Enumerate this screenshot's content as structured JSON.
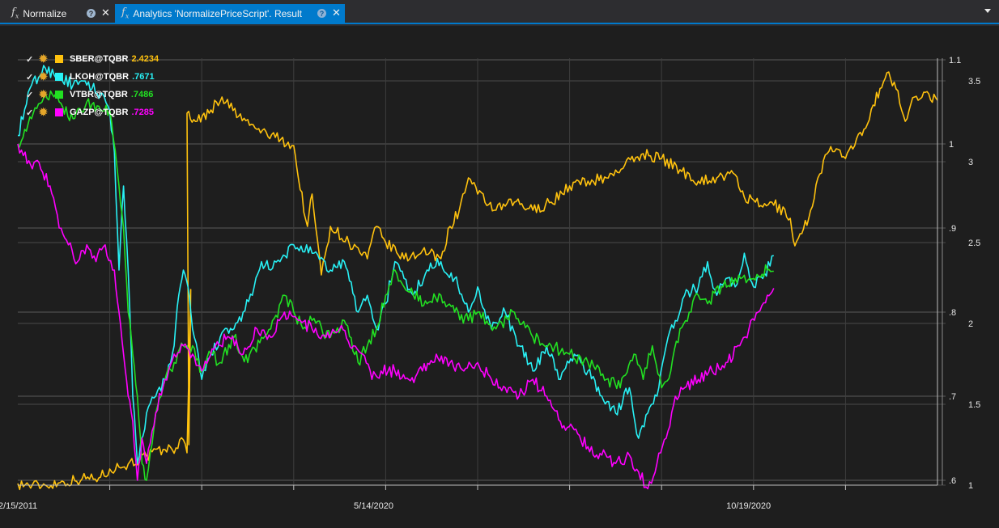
{
  "tabs": [
    {
      "label": "Normalize",
      "icon": "function-icon"
    },
    {
      "label": "Analytics 'NormalizePriceScript'. Result",
      "icon": "function-icon"
    }
  ],
  "chart_data": {
    "type": "line",
    "x_tick_labels": [
      "2/15/2011",
      "5/14/2020",
      "10/19/2020"
    ],
    "y_axis_inner": {
      "ticks": [
        "1.1",
        "1",
        ".9",
        ".8",
        ".7",
        ".6"
      ],
      "range": [
        0.6,
        1.1
      ]
    },
    "y_axis_outer": {
      "ticks": [
        "3.5",
        "3",
        "2.5",
        "2",
        "1.5",
        "1"
      ],
      "range": [
        1.0,
        3.5
      ]
    },
    "legend_position": "top-left",
    "series": [
      {
        "name": "SBER@TQBR",
        "last_value": "2.4234",
        "color": "#ffc20e",
        "axis": "outer",
        "points": [
          [
            0.0,
            1.01
          ],
          [
            0.012,
            1.0
          ],
          [
            0.03,
            1.0
          ],
          [
            0.05,
            1.02
          ],
          [
            0.07,
            1.04
          ],
          [
            0.09,
            1.05
          ],
          [
            0.1,
            1.1
          ],
          [
            0.12,
            1.13
          ],
          [
            0.14,
            1.18
          ],
          [
            0.16,
            1.22
          ],
          [
            0.172,
            1.23
          ],
          [
            0.18,
            1.28
          ],
          [
            0.184,
            1.2
          ],
          [
            0.188,
            2.21
          ],
          [
            0.186,
            1.25
          ],
          [
            0.184,
            3.3
          ],
          [
            0.195,
            3.25
          ],
          [
            0.21,
            3.32
          ],
          [
            0.222,
            3.4
          ],
          [
            0.24,
            3.28
          ],
          [
            0.26,
            3.2
          ],
          [
            0.28,
            3.15
          ],
          [
            0.3,
            3.1
          ],
          [
            0.305,
            2.9
          ],
          [
            0.315,
            2.6
          ],
          [
            0.32,
            2.8
          ],
          [
            0.33,
            2.3
          ],
          [
            0.34,
            2.6
          ],
          [
            0.36,
            2.5
          ],
          [
            0.38,
            2.4
          ],
          [
            0.39,
            2.6
          ],
          [
            0.4,
            2.5
          ],
          [
            0.42,
            2.4
          ],
          [
            0.44,
            2.45
          ],
          [
            0.46,
            2.4
          ],
          [
            0.47,
            2.6
          ],
          [
            0.48,
            2.7
          ],
          [
            0.49,
            2.9
          ],
          [
            0.5,
            2.8
          ],
          [
            0.52,
            2.7
          ],
          [
            0.54,
            2.75
          ],
          [
            0.56,
            2.7
          ],
          [
            0.58,
            2.75
          ],
          [
            0.6,
            2.85
          ],
          [
            0.62,
            2.88
          ],
          [
            0.64,
            2.9
          ],
          [
            0.66,
            2.98
          ],
          [
            0.68,
            3.05
          ],
          [
            0.7,
            3.02
          ],
          [
            0.72,
            2.95
          ],
          [
            0.74,
            2.88
          ],
          [
            0.76,
            2.9
          ],
          [
            0.78,
            2.92
          ],
          [
            0.79,
            2.78
          ],
          [
            0.81,
            2.72
          ],
          [
            0.82,
            2.75
          ],
          [
            0.84,
            2.65
          ],
          [
            0.845,
            2.48
          ],
          [
            0.86,
            2.65
          ],
          [
            0.87,
            2.9
          ],
          [
            0.88,
            3.05
          ],
          [
            0.89,
            3.08
          ],
          [
            0.9,
            3.02
          ],
          [
            0.91,
            3.1
          ],
          [
            0.92,
            3.2
          ],
          [
            0.93,
            3.35
          ],
          [
            0.945,
            3.55
          ],
          [
            0.955,
            3.45
          ],
          [
            0.965,
            3.25
          ],
          [
            0.975,
            3.4
          ],
          [
            0.985,
            3.43
          ],
          [
            1.0,
            3.38
          ]
        ]
      },
      {
        "name": "LKOH@TQBR",
        "last_value": ".7671",
        "color": "#28f1f5",
        "axis": "inner",
        "points": [
          [
            0.0,
            1.01
          ],
          [
            0.015,
            1.07
          ],
          [
            0.03,
            1.09
          ],
          [
            0.045,
            1.08
          ],
          [
            0.06,
            1.07
          ],
          [
            0.075,
            1.07
          ],
          [
            0.09,
            1.06
          ],
          [
            0.1,
            1.04
          ],
          [
            0.105,
            0.99
          ],
          [
            0.11,
            0.85
          ],
          [
            0.115,
            0.95
          ],
          [
            0.12,
            0.85
          ],
          [
            0.125,
            0.7
          ],
          [
            0.13,
            0.62
          ],
          [
            0.14,
            0.68
          ],
          [
            0.15,
            0.7
          ],
          [
            0.16,
            0.72
          ],
          [
            0.17,
            0.76
          ],
          [
            0.175,
            0.82
          ],
          [
            0.18,
            0.85
          ],
          [
            0.185,
            0.83
          ],
          [
            0.19,
            0.78
          ],
          [
            0.2,
            0.72
          ],
          [
            0.21,
            0.75
          ],
          [
            0.22,
            0.77
          ],
          [
            0.235,
            0.78
          ],
          [
            0.245,
            0.8
          ],
          [
            0.255,
            0.82
          ],
          [
            0.265,
            0.86
          ],
          [
            0.275,
            0.85
          ],
          [
            0.285,
            0.86
          ],
          [
            0.3,
            0.88
          ],
          [
            0.32,
            0.87
          ],
          [
            0.34,
            0.85
          ],
          [
            0.355,
            0.86
          ],
          [
            0.37,
            0.8
          ],
          [
            0.38,
            0.82
          ],
          [
            0.39,
            0.78
          ],
          [
            0.4,
            0.81
          ],
          [
            0.41,
            0.86
          ],
          [
            0.42,
            0.84
          ],
          [
            0.43,
            0.82
          ],
          [
            0.445,
            0.85
          ],
          [
            0.46,
            0.86
          ],
          [
            0.475,
            0.84
          ],
          [
            0.49,
            0.8
          ],
          [
            0.5,
            0.83
          ],
          [
            0.515,
            0.78
          ],
          [
            0.53,
            0.8
          ],
          [
            0.545,
            0.76
          ],
          [
            0.56,
            0.73
          ],
          [
            0.575,
            0.76
          ],
          [
            0.59,
            0.72
          ],
          [
            0.605,
            0.75
          ],
          [
            0.62,
            0.73
          ],
          [
            0.635,
            0.7
          ],
          [
            0.65,
            0.68
          ],
          [
            0.665,
            0.71
          ],
          [
            0.675,
            0.65
          ],
          [
            0.685,
            0.68
          ],
          [
            0.695,
            0.7
          ],
          [
            0.705,
            0.76
          ],
          [
            0.715,
            0.79
          ],
          [
            0.725,
            0.82
          ],
          [
            0.74,
            0.83
          ],
          [
            0.75,
            0.86
          ],
          [
            0.76,
            0.82
          ],
          [
            0.77,
            0.84
          ],
          [
            0.78,
            0.83
          ],
          [
            0.79,
            0.87
          ],
          [
            0.8,
            0.83
          ],
          [
            0.81,
            0.84
          ],
          [
            0.822,
            0.8671
          ]
        ]
      },
      {
        "name": "VTBR@TQBR",
        "last_value": ".7486",
        "color": "#22e022",
        "axis": "inner",
        "points": [
          [
            0.0,
            1.0
          ],
          [
            0.015,
            1.03
          ],
          [
            0.03,
            1.06
          ],
          [
            0.045,
            1.05
          ],
          [
            0.06,
            1.03
          ],
          [
            0.075,
            1.05
          ],
          [
            0.09,
            1.04
          ],
          [
            0.1,
            1.04
          ],
          [
            0.11,
            0.95
          ],
          [
            0.115,
            0.9
          ],
          [
            0.12,
            0.8
          ],
          [
            0.125,
            0.75
          ],
          [
            0.13,
            0.7
          ],
          [
            0.135,
            0.62
          ],
          [
            0.14,
            0.6
          ],
          [
            0.15,
            0.68
          ],
          [
            0.16,
            0.72
          ],
          [
            0.17,
            0.74
          ],
          [
            0.18,
            0.76
          ],
          [
            0.19,
            0.76
          ],
          [
            0.2,
            0.73
          ],
          [
            0.21,
            0.75
          ],
          [
            0.22,
            0.74
          ],
          [
            0.235,
            0.77
          ],
          [
            0.25,
            0.74
          ],
          [
            0.265,
            0.77
          ],
          [
            0.275,
            0.78
          ],
          [
            0.29,
            0.82
          ],
          [
            0.3,
            0.8
          ],
          [
            0.31,
            0.78
          ],
          [
            0.32,
            0.79
          ],
          [
            0.34,
            0.77
          ],
          [
            0.355,
            0.79
          ],
          [
            0.37,
            0.74
          ],
          [
            0.38,
            0.76
          ],
          [
            0.39,
            0.78
          ],
          [
            0.4,
            0.82
          ],
          [
            0.41,
            0.85
          ],
          [
            0.42,
            0.83
          ],
          [
            0.43,
            0.82
          ],
          [
            0.445,
            0.81
          ],
          [
            0.46,
            0.82
          ],
          [
            0.475,
            0.8
          ],
          [
            0.49,
            0.79
          ],
          [
            0.5,
            0.8
          ],
          [
            0.52,
            0.78
          ],
          [
            0.54,
            0.8
          ],
          [
            0.56,
            0.77
          ],
          [
            0.58,
            0.76
          ],
          [
            0.6,
            0.75
          ],
          [
            0.62,
            0.74
          ],
          [
            0.64,
            0.72
          ],
          [
            0.655,
            0.71
          ],
          [
            0.67,
            0.75
          ],
          [
            0.68,
            0.72
          ],
          [
            0.69,
            0.76
          ],
          [
            0.7,
            0.71
          ],
          [
            0.71,
            0.73
          ],
          [
            0.72,
            0.78
          ],
          [
            0.73,
            0.8
          ],
          [
            0.74,
            0.82
          ],
          [
            0.75,
            0.81
          ],
          [
            0.765,
            0.83
          ],
          [
            0.78,
            0.84
          ],
          [
            0.8,
            0.84
          ],
          [
            0.815,
            0.85
          ],
          [
            0.822,
            0.8486
          ]
        ]
      },
      {
        "name": "GAZP@TQBR",
        "last_value": ".7285",
        "color": "#ff00ff",
        "axis": "inner",
        "points": [
          [
            0.0,
            1.0
          ],
          [
            0.012,
            0.98
          ],
          [
            0.025,
            0.97
          ],
          [
            0.035,
            0.95
          ],
          [
            0.045,
            0.9
          ],
          [
            0.055,
            0.88
          ],
          [
            0.065,
            0.86
          ],
          [
            0.075,
            0.88
          ],
          [
            0.085,
            0.86
          ],
          [
            0.095,
            0.88
          ],
          [
            0.105,
            0.85
          ],
          [
            0.11,
            0.8
          ],
          [
            0.115,
            0.75
          ],
          [
            0.12,
            0.7
          ],
          [
            0.125,
            0.67
          ],
          [
            0.13,
            0.6
          ],
          [
            0.135,
            0.65
          ],
          [
            0.14,
            0.62
          ],
          [
            0.15,
            0.68
          ],
          [
            0.16,
            0.72
          ],
          [
            0.17,
            0.75
          ],
          [
            0.18,
            0.76
          ],
          [
            0.19,
            0.75
          ],
          [
            0.2,
            0.73
          ],
          [
            0.215,
            0.76
          ],
          [
            0.23,
            0.77
          ],
          [
            0.245,
            0.75
          ],
          [
            0.26,
            0.78
          ],
          [
            0.275,
            0.77
          ],
          [
            0.29,
            0.8
          ],
          [
            0.305,
            0.79
          ],
          [
            0.32,
            0.78
          ],
          [
            0.335,
            0.77
          ],
          [
            0.35,
            0.78
          ],
          [
            0.365,
            0.76
          ],
          [
            0.375,
            0.75
          ],
          [
            0.385,
            0.72
          ],
          [
            0.395,
            0.73
          ],
          [
            0.41,
            0.73
          ],
          [
            0.425,
            0.72
          ],
          [
            0.44,
            0.73
          ],
          [
            0.455,
            0.75
          ],
          [
            0.47,
            0.74
          ],
          [
            0.485,
            0.73
          ],
          [
            0.5,
            0.74
          ],
          [
            0.515,
            0.72
          ],
          [
            0.53,
            0.71
          ],
          [
            0.545,
            0.7
          ],
          [
            0.56,
            0.72
          ],
          [
            0.575,
            0.7
          ],
          [
            0.59,
            0.67
          ],
          [
            0.605,
            0.66
          ],
          [
            0.62,
            0.64
          ],
          [
            0.635,
            0.63
          ],
          [
            0.65,
            0.62
          ],
          [
            0.665,
            0.63
          ],
          [
            0.675,
            0.61
          ],
          [
            0.685,
            0.59
          ],
          [
            0.695,
            0.62
          ],
          [
            0.705,
            0.65
          ],
          [
            0.715,
            0.7
          ],
          [
            0.725,
            0.71
          ],
          [
            0.74,
            0.72
          ],
          [
            0.755,
            0.73
          ],
          [
            0.77,
            0.74
          ],
          [
            0.785,
            0.76
          ],
          [
            0.795,
            0.78
          ],
          [
            0.805,
            0.8
          ],
          [
            0.815,
            0.82
          ],
          [
            0.822,
            0.8285
          ]
        ]
      }
    ]
  }
}
